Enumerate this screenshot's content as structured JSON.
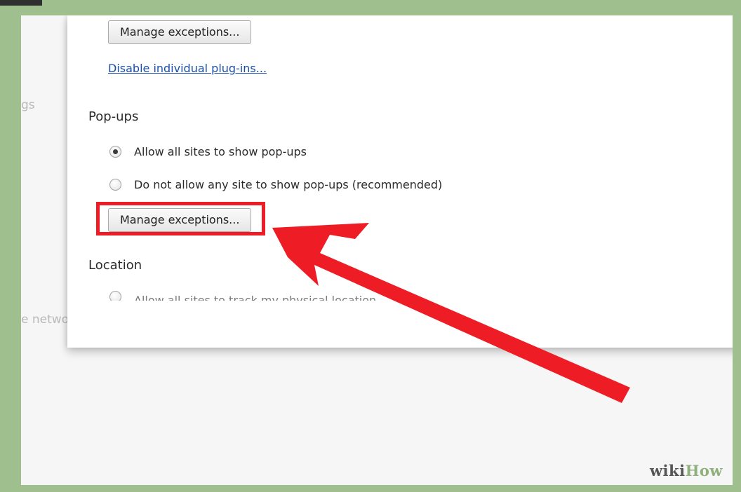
{
  "settings_dialog": {
    "plugins_manage_button": "Manage exceptions...",
    "plugins_disable_link": "Disable individual plug-ins...",
    "popups": {
      "heading": "Pop-ups",
      "options": [
        {
          "label": "Allow all sites to show pop-ups",
          "checked": true
        },
        {
          "label": "Do not allow any site to show pop-ups (recommended)",
          "checked": false
        }
      ],
      "manage_button": "Manage exceptions..."
    },
    "location": {
      "heading": "Location",
      "cut_option": "Allow all sites to track my physical location"
    }
  },
  "background_page": {
    "fragment_1": "gs",
    "fragment_2": "e netwo"
  },
  "annotation": {
    "highlight_color": "#ee1c25",
    "arrow_color": "#ee1c25"
  },
  "watermark": {
    "part1": "wiki",
    "part2": "How"
  }
}
